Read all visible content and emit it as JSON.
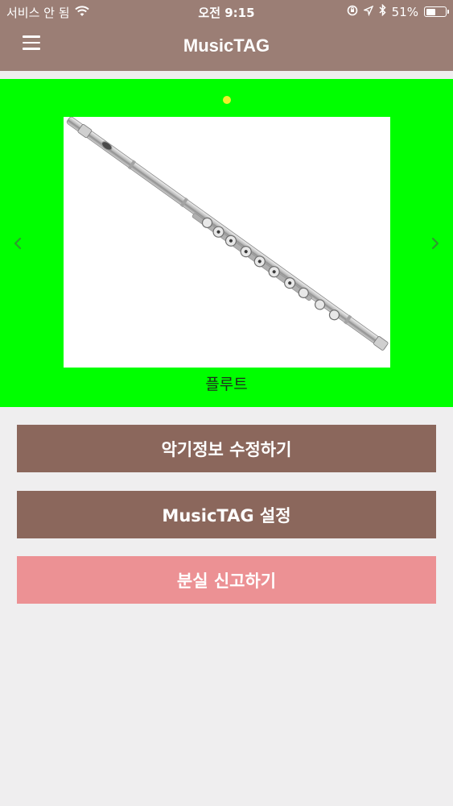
{
  "status_bar": {
    "carrier": "서비스 안 됨",
    "time": "오전 9:15",
    "battery_percent": "51%",
    "battery_level": 0.51,
    "icons": [
      "wifi-icon",
      "lock-rotation-icon",
      "location-icon",
      "bluetooth-icon",
      "battery-icon"
    ]
  },
  "header": {
    "title": "MusicTAG",
    "menu_icon": "hamburger-menu-icon"
  },
  "carousel": {
    "current_page": 1,
    "page_count": 1,
    "item_name": "플루트",
    "prev_icon": "chevron-left-icon",
    "next_icon": "chevron-right-icon"
  },
  "actions": {
    "edit_label": "악기정보 수정하기",
    "settings_label": "MusicTAG 설정",
    "report_label": "분실 신고하기"
  },
  "colors": {
    "app_bar": "#9b7e75",
    "carousel_background": "#00ff00",
    "page_dot": "#f2ef2a",
    "primary_button": "#8b675c",
    "report_button": "#ec9194",
    "background": "#efeeef"
  }
}
